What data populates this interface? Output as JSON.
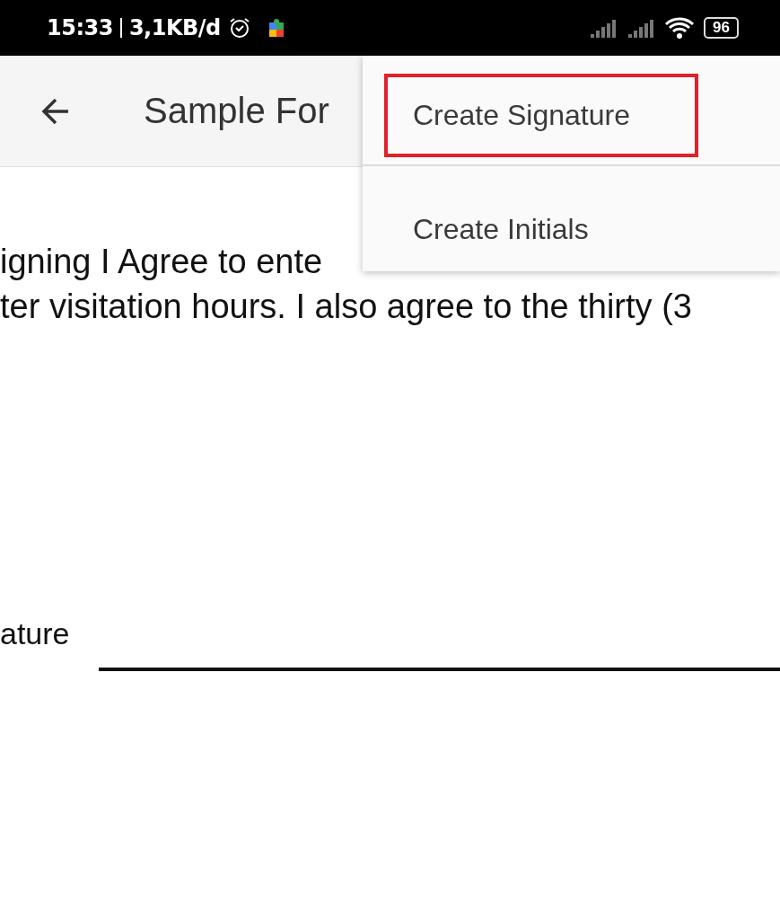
{
  "status_bar": {
    "time": "15:33",
    "speed": "3,1KB/d",
    "battery": "96"
  },
  "app_bar": {
    "title": "Sample For"
  },
  "menu": {
    "items": [
      {
        "label": "Create Signature",
        "highlighted": true
      },
      {
        "label": "Create Initials",
        "highlighted": false
      }
    ]
  },
  "document": {
    "lines": [
      "igning I Agree to ente",
      "ter visitation hours. I also agree to the thirty (3"
    ],
    "signature_label": "ature"
  }
}
